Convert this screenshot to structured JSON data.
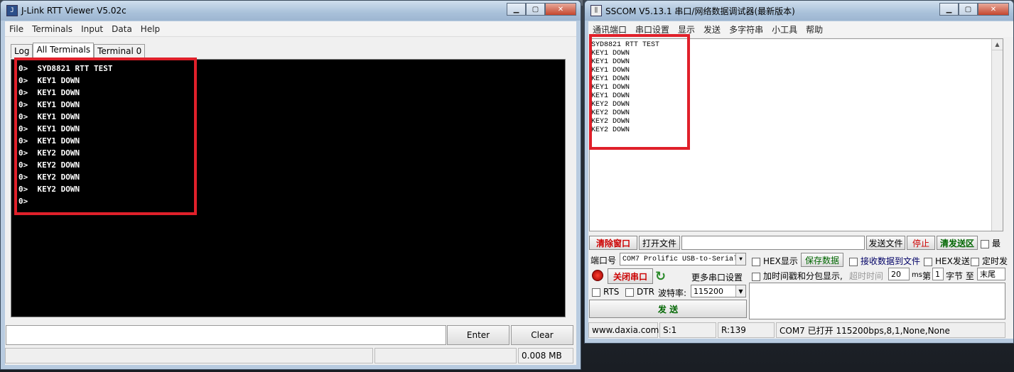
{
  "jlink": {
    "title": "J-Link RTT Viewer V5.02c",
    "icon": "jlink-app-icon",
    "menu": [
      "File",
      "Terminals",
      "Input",
      "Data",
      "Help"
    ],
    "tabs": [
      "Log",
      "All Terminals",
      "Terminal 0"
    ],
    "terminal_lines": [
      "0>  SYD8821 RTT TEST",
      "0>  KEY1 DOWN",
      "0>  KEY1 DOWN",
      "0>  KEY1 DOWN",
      "0>  KEY1 DOWN",
      "0>  KEY1 DOWN",
      "0>  KEY1 DOWN",
      "0>  KEY2 DOWN",
      "0>  KEY2 DOWN",
      "0>  KEY2 DOWN",
      "0>  KEY2 DOWN",
      "0>"
    ],
    "input_value": "",
    "enter_label": "Enter",
    "clear_label": "Clear",
    "status_size": "0.008 MB"
  },
  "sscom": {
    "title": "SSCOM V5.13.1 串口/网络数据调试器(最新版本)",
    "menu": [
      "通讯端口",
      "串口设置",
      "显示",
      "发送",
      "多字符串",
      "小工具",
      "帮助"
    ],
    "receive_lines": [
      "SYD8821 RTT TEST",
      "KEY1 DOWN",
      "KEY1 DOWN",
      "KEY1 DOWN",
      "KEY1 DOWN",
      "KEY1 DOWN",
      "KEY1 DOWN",
      "KEY2 DOWN",
      "KEY2 DOWN",
      "KEY2 DOWN",
      "KEY2 DOWN"
    ],
    "clear_window": "清除窗口",
    "open_file": "打开文件",
    "send_file": "发送文件",
    "stop": "停止",
    "clear_send": "清发送区",
    "last_label": "最",
    "port_label": "端口号",
    "port_value": "COM7 Prolific USB-to-Serial",
    "hex_display": "HEX显示",
    "save_data": "保存数据",
    "recv_to_file": "接收数据到文件",
    "hex_send": "HEX发送",
    "timed_send": "定时发",
    "close_port": "关闭串口",
    "more_settings": "更多串口设置",
    "timestamp": "加时间戳和分包显示,",
    "timeout_label": "超时时间",
    "timeout_value": "20",
    "ms": "ms",
    "nth_label": "第",
    "nth_value": "1",
    "byte_label": "字节 至",
    "end_value": "末尾",
    "rts": "RTS",
    "dtr": "DTR",
    "baud_label": "波特率:",
    "baud_value": "115200",
    "send_label": "发 送",
    "status_site": "www.daxia.com",
    "status_s": "S:1",
    "status_r": "R:139",
    "status_port": "COM7 已打开  115200bps,8,1,None,None",
    "accent_red": "#cc0000",
    "accent_green": "#006600"
  }
}
